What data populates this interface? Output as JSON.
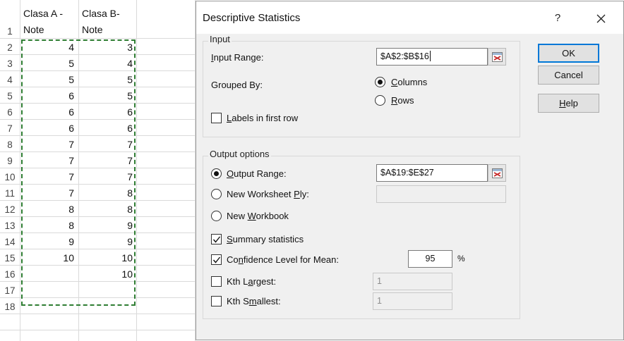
{
  "sheet": {
    "row_numbers": [
      "1",
      "2",
      "3",
      "4",
      "5",
      "6",
      "7",
      "8",
      "9",
      "10",
      "11",
      "12",
      "13",
      "14",
      "15",
      "16",
      "17",
      "18"
    ],
    "col_a_header_line1": "Clasa A -",
    "col_a_header_line2": "Note",
    "col_b_header_line1": "Clasa B-",
    "col_b_header_line2": "Note",
    "col_a_values": [
      "4",
      "5",
      "5",
      "6",
      "6",
      "6",
      "7",
      "7",
      "7",
      "7",
      "8",
      "8",
      "9",
      "10"
    ],
    "col_b_values": [
      "3",
      "4",
      "5",
      "5",
      "6",
      "6",
      "7",
      "7",
      "7",
      "8",
      "8",
      "9",
      "9",
      "10",
      "10"
    ]
  },
  "dialog": {
    "title": "Descriptive Statistics",
    "help_char": "?",
    "input_group_label": "Input",
    "input_range_label": "Input Range:",
    "input_range_value": "$A$2:$B$16",
    "grouped_by_label": "Grouped By:",
    "columns_label": "Columns",
    "rows_label": "Rows",
    "labels_first_row": "Labels in first row",
    "output_group_label": "Output options",
    "output_range_label": "Output Range:",
    "output_range_value": "$A$19:$E$27",
    "new_worksheet_label": "New Worksheet Ply:",
    "new_workbook_label": "New Workbook",
    "summary_stats_label": "Summary statistics",
    "confidence_label": "Confidence Level for Mean:",
    "confidence_value": "95",
    "percent_sign": "%",
    "kth_largest_label": "Kth Largest:",
    "kth_largest_value": "1",
    "kth_smallest_label": "Kth Smallest:",
    "kth_smallest_value": "1",
    "ok_label": "OK",
    "cancel_label": "Cancel",
    "help_label": "Help"
  },
  "colors": {
    "marquee": "#2e7d32",
    "default_button_border": "#0078d7",
    "ref_icon_red": "#c62828"
  }
}
